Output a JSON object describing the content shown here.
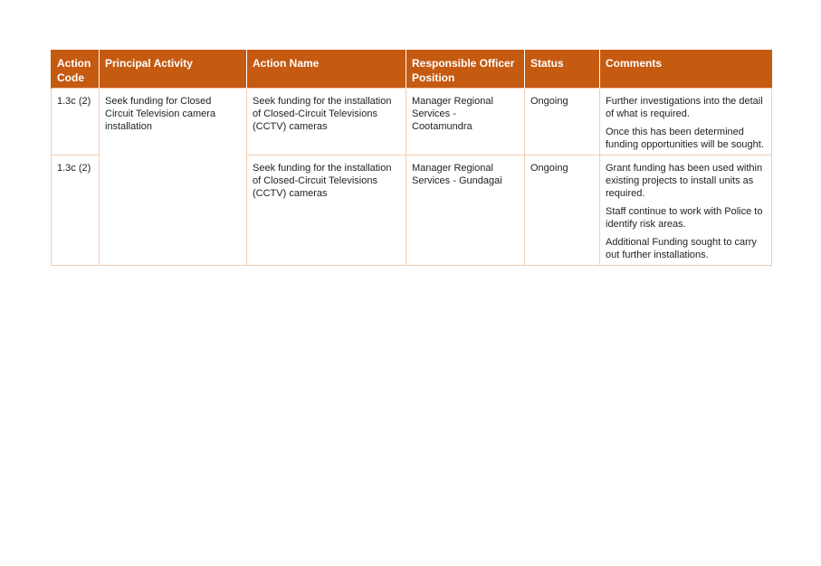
{
  "table": {
    "headers": {
      "action_code": "Action Code",
      "principal_activity": "Principal Activity",
      "action_name": "Action Name",
      "responsible_officer": "Responsible Officer Position",
      "status": "Status",
      "comments": "Comments"
    },
    "principal_activity": "Seek funding for Closed Circuit Television camera installation",
    "rows": [
      {
        "action_code": "1.3c (2)",
        "action_name": "Seek funding for the installation of Closed-Circuit Televisions (CCTV) cameras",
        "responsible_officer": "Manager Regional Services - Cootamundra",
        "status": "Ongoing",
        "comments": [
          "Further investigations into the detail of what is required.",
          "Once this has been determined funding opportunities will be sought."
        ]
      },
      {
        "action_code": "1.3c (2)",
        "action_name": "Seek funding for the installation of Closed-Circuit Televisions (CCTV) cameras",
        "responsible_officer": "Manager Regional Services - Gundagai",
        "status": "Ongoing",
        "comments": [
          "Grant funding has been used within existing projects to install units as required.",
          "Staff continue to work with Police to identify risk areas.",
          "Additional Funding sought to carry out further installations."
        ]
      }
    ]
  },
  "colors": {
    "header_background": "#c55a11",
    "header_text": "#ffffff",
    "cell_border": "#f4cdb2"
  }
}
